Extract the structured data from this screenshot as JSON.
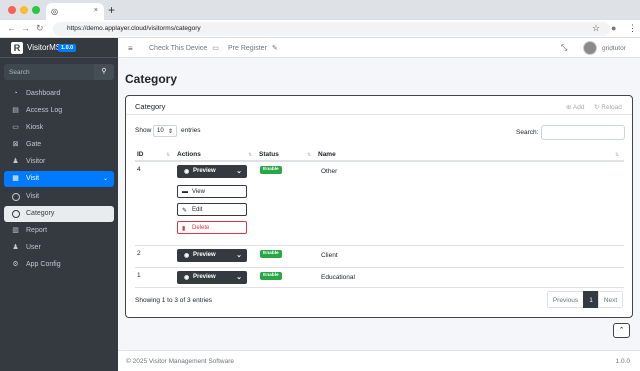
{
  "browser": {
    "url": "https://demo.applayer.cloud/visitorms/category",
    "tab_close": "×",
    "new_tab": "+",
    "back_icon": "←",
    "forward_icon": "→",
    "reload_icon": "↻",
    "star_icon": "☆",
    "profile_icon": "●",
    "kebab_icon": "⋮",
    "traffic_colors": [
      "#fe5f57",
      "#febc2e",
      "#28c840"
    ]
  },
  "brand": {
    "logo": "R",
    "name": "VisitorMS",
    "version": "1.0.0"
  },
  "sidebar": {
    "search_placeholder": "Search",
    "search_icon": "🔍",
    "items": [
      {
        "label": "Dashboard",
        "icon": "◔"
      },
      {
        "label": "Access Log",
        "icon": "▤"
      },
      {
        "label": "Kiosk",
        "icon": "▭"
      },
      {
        "label": "Gate",
        "icon": "⊠"
      },
      {
        "label": "Visitor",
        "icon": "♟"
      },
      {
        "label": "Visit",
        "icon": "▦",
        "chevron": "⌄"
      },
      {
        "label": "Visit"
      },
      {
        "label": "Category"
      },
      {
        "label": "Report",
        "icon": "▥"
      },
      {
        "label": "User",
        "icon": "♟"
      },
      {
        "label": "App Config",
        "icon": "⚙"
      }
    ]
  },
  "topnav": {
    "menu_icon": "≡",
    "check_device": "Check This Device",
    "check_icon": "▭",
    "pre_register": "Pre Register",
    "pre_icon": "✎",
    "expand_icon": "⤡",
    "username": "gridtutor"
  },
  "page": {
    "title": "Category"
  },
  "card": {
    "title": "Category",
    "add_label": "Add",
    "add_icon": "⊕",
    "reload_label": "Reload",
    "reload_icon": "↻",
    "show_label": "Show",
    "length_value": "10",
    "length_chevron": "⇕",
    "entries_label": "entries",
    "search_label": "Search:",
    "columns": [
      "ID",
      "Actions",
      "Status",
      "Name"
    ],
    "sort_icon": "⇅",
    "rows": [
      {
        "id": "4",
        "action": "Preview",
        "status": "Enable",
        "name": "Other"
      },
      {
        "id": "2",
        "action": "Preview",
        "status": "Enable",
        "name": "Client"
      },
      {
        "id": "1",
        "action": "Preview",
        "status": "Enable",
        "name": "Educational"
      }
    ],
    "preview_icon": "◉",
    "preview_chevron": "⌄",
    "menu": [
      {
        "label": "View",
        "icon": "▬"
      },
      {
        "label": "Edit",
        "icon": "✎"
      },
      {
        "label": "Delete",
        "icon": "▮"
      }
    ],
    "info": "Showing 1 to 3 of 3 entries",
    "pagination": {
      "previous": "Previous",
      "current": "1",
      "next": "Next"
    }
  },
  "scroll_top_icon": "⌃",
  "footer": {
    "copyright": "© 2025 Visitor Management Software",
    "version": "1.0.0"
  }
}
